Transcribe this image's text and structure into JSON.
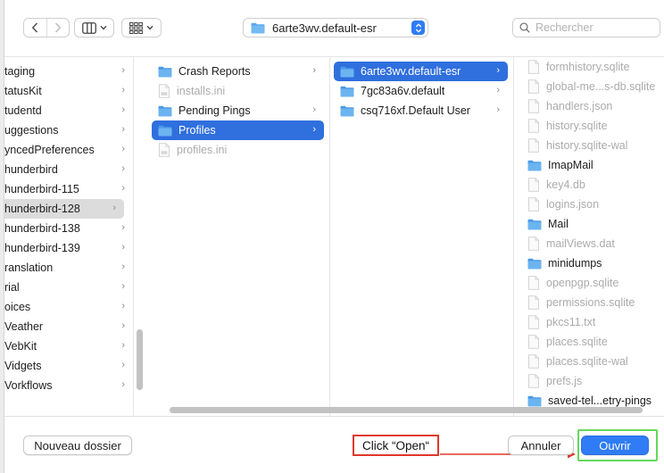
{
  "toolbar": {
    "path_label": "6arte3wv.default-esr",
    "search_placeholder": "Rechercher"
  },
  "column1": {
    "items": [
      {
        "label": "taging",
        "has_children": true
      },
      {
        "label": "tatusKit",
        "has_children": true
      },
      {
        "label": "tudentd",
        "has_children": true
      },
      {
        "label": "uggestions",
        "has_children": true
      },
      {
        "label": "yncedPreferences",
        "has_children": true
      },
      {
        "label": "hunderbird",
        "has_children": true
      },
      {
        "label": "hunderbird-115",
        "has_children": true
      },
      {
        "label": "hunderbird-128",
        "has_children": true,
        "highlighted": true
      },
      {
        "label": "hunderbird-138",
        "has_children": true
      },
      {
        "label": "hunderbird-139",
        "has_children": true
      },
      {
        "label": "ranslation",
        "has_children": true
      },
      {
        "label": "rial",
        "has_children": true
      },
      {
        "label": "oices",
        "has_children": true
      },
      {
        "label": "Veather",
        "has_children": true
      },
      {
        "label": "VebKit",
        "has_children": true
      },
      {
        "label": "Vidgets",
        "has_children": true
      },
      {
        "label": "Vorkflows",
        "has_children": true
      }
    ]
  },
  "column2": {
    "items": [
      {
        "label": "Crash Reports",
        "kind": "folder",
        "has_children": true
      },
      {
        "label": "installs.ini",
        "kind": "ini",
        "dim": true
      },
      {
        "label": "Pending Pings",
        "kind": "folder",
        "has_children": true
      },
      {
        "label": "Profiles",
        "kind": "folder",
        "has_children": true,
        "selected": true
      },
      {
        "label": "profiles.ini",
        "kind": "ini",
        "dim": true
      }
    ]
  },
  "column3": {
    "items": [
      {
        "label": "6arte3wv.default-esr",
        "kind": "folder",
        "has_children": true,
        "selected": true
      },
      {
        "label": "7gc83a6v.default",
        "kind": "folder",
        "has_children": true
      },
      {
        "label": "csq716xf.Default User",
        "kind": "folder",
        "has_children": true
      }
    ]
  },
  "column4": {
    "items": [
      {
        "label": "formhistory.sqlite",
        "kind": "file",
        "dim": true
      },
      {
        "label": "global-me...s-db.sqlite",
        "kind": "file",
        "dim": true
      },
      {
        "label": "handlers.json",
        "kind": "file",
        "dim": true
      },
      {
        "label": "history.sqlite",
        "kind": "file",
        "dim": true
      },
      {
        "label": "history.sqlite-wal",
        "kind": "file",
        "dim": true
      },
      {
        "label": "ImapMail",
        "kind": "folder"
      },
      {
        "label": "key4.db",
        "kind": "file",
        "dim": true
      },
      {
        "label": "logins.json",
        "kind": "file",
        "dim": true
      },
      {
        "label": "Mail",
        "kind": "folder"
      },
      {
        "label": "mailViews.dat",
        "kind": "file",
        "dim": true
      },
      {
        "label": "minidumps",
        "kind": "folder"
      },
      {
        "label": "openpgp.sqlite",
        "kind": "file",
        "dim": true
      },
      {
        "label": "permissions.sqlite",
        "kind": "file",
        "dim": true
      },
      {
        "label": "pkcs11.txt",
        "kind": "txt",
        "dim": true
      },
      {
        "label": "places.sqlite",
        "kind": "file",
        "dim": true
      },
      {
        "label": "places.sqlite-wal",
        "kind": "file",
        "dim": true
      },
      {
        "label": "prefs.js",
        "kind": "js",
        "dim": true
      },
      {
        "label": "saved-tel...etry-pings",
        "kind": "folder"
      }
    ]
  },
  "bottom": {
    "new_folder_label": "Nouveau dossier",
    "cancel_label": "Annuler",
    "open_label": "Ouvrir",
    "annotation_text": "Click “Open“"
  },
  "colors": {
    "accent": "#2f7cf6",
    "selection": "#2f6fde",
    "folder": "#5aa7ec",
    "annotation_red": "#e0382a",
    "annotation_green": "#63d95a"
  }
}
